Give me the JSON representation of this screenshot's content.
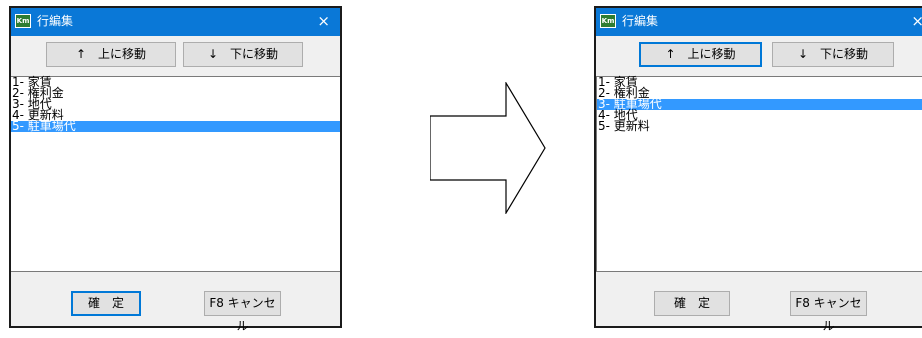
{
  "dialogs": [
    {
      "title": "行編集",
      "icon_label": "Km",
      "close_glyph": "×",
      "move_up_label": "↑　上に移動",
      "move_down_label": "↓　下に移動",
      "items": [
        "1- 家賃",
        "2- 権利金",
        "3- 地代",
        "4- 更新料",
        "5- 駐車場代"
      ],
      "selected_index": 4,
      "confirm_label": "確　定",
      "cancel_label": "F8 キャンセル"
    },
    {
      "title": "行編集",
      "icon_label": "Km",
      "close_glyph": "×",
      "move_up_label": "↑　上に移動",
      "move_down_label": "↓　下に移動",
      "items": [
        "1- 家賃",
        "2- 権利金",
        "3- 駐車場代",
        "4- 地代",
        "5- 更新料"
      ],
      "selected_index": 2,
      "confirm_label": "確　定",
      "cancel_label": "F8 キャンセル"
    }
  ],
  "colors": {
    "titlebar": "#0a78d7",
    "selection": "#3399ff",
    "focus_border": "#0078d7"
  },
  "icons": {
    "app": "app-logo-icon",
    "close": "close-icon",
    "arrow": "right-arrow-icon"
  }
}
